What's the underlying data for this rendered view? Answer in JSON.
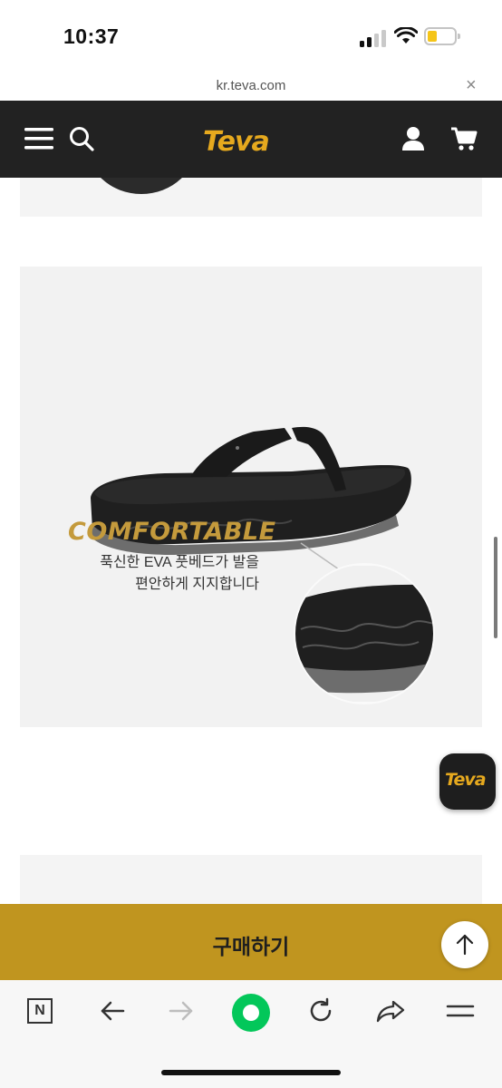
{
  "status_bar": {
    "time": "10:37"
  },
  "browser": {
    "url": "kr.teva.com",
    "close_glyph": "×"
  },
  "header": {
    "logo": "Teva",
    "icons": [
      "menu-icon",
      "search-icon",
      "user-icon",
      "cart-icon"
    ],
    "background": "#222222",
    "brand_color": "#e6a91e"
  },
  "feature": {
    "title": "COMFORTABLE",
    "description_lines": [
      "푹신한 EVA 풋베드가 발을",
      "편안하게 지지합니다"
    ],
    "title_color": "#c49a3c"
  },
  "floating_badge": {
    "label": "Teva"
  },
  "buy_bar": {
    "label": "구매하기",
    "color": "#c0951f"
  },
  "bottom_toolbar": {
    "n_label": "N",
    "icons": [
      "naver-n-icon",
      "back-arrow-icon",
      "forward-arrow-icon",
      "naver-green-dot-icon",
      "reload-icon",
      "share-icon",
      "menu-lines-icon"
    ],
    "green": "#03c75a"
  }
}
